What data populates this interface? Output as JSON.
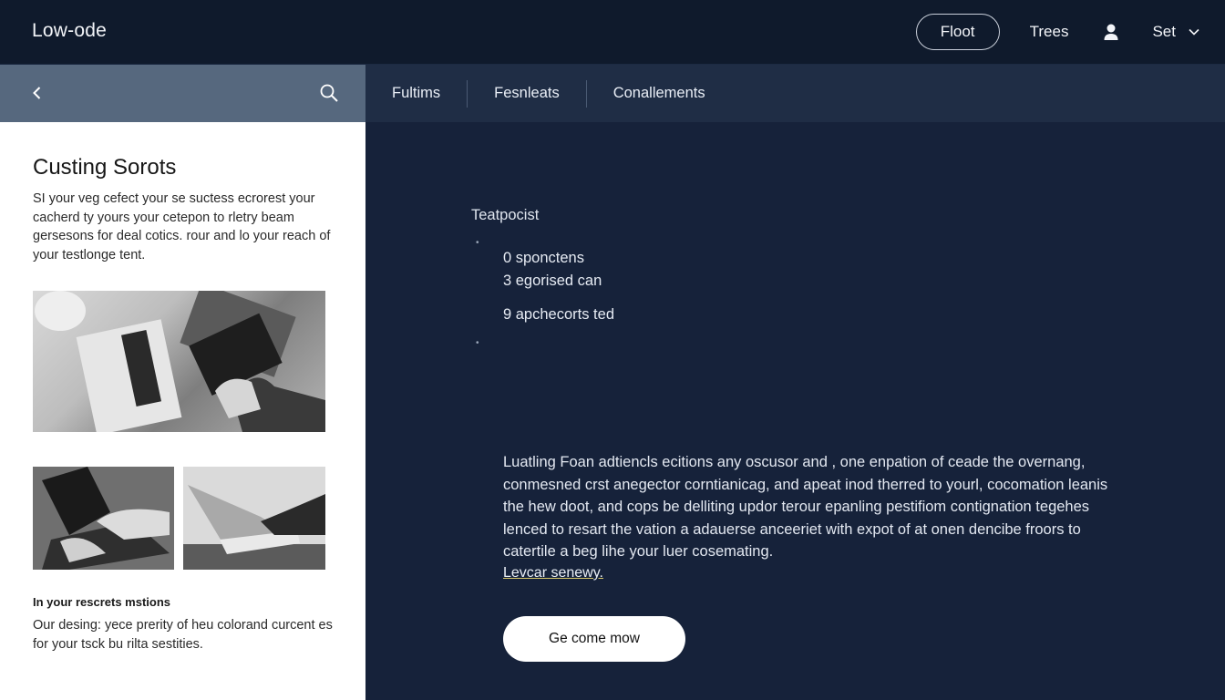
{
  "app": {
    "brand": "Low-ode"
  },
  "topbar": {
    "pill_button": "Floot",
    "link": "Trees",
    "user_icon": "user-icon",
    "settings_label": "Set",
    "settings_chevron_icon": "chevron-down-icon"
  },
  "sidebar": {
    "back_icon": "chevron-left-icon",
    "search_icon": "search-icon",
    "title": "Custing Sorots",
    "description": "SI your veg cefect your se suctess ecrorest your cacherd ty yours your cetepon to rletry beam gersesons for deal cotics. rour and lo your reach of your testlonge tent.",
    "subheading": "In your rescrets mstions",
    "footer_text": "Our desing: yece prerity of heu colorand curcent es for your tsck bu rilta sestities."
  },
  "tabs": [
    "Fultims",
    "Fesnleats",
    "Conallements"
  ],
  "main": {
    "section_label": "Teatpocist",
    "stats": [
      "0 sponctens",
      "3 egorised can",
      "9 apchecorts ted"
    ],
    "body": "Luatling Foan adtiencls ecitions any oscusor and , one enpation of ceade the overnang, conmesned crst anegector corntianicag, and apeat inod therred to yourl, cocomation leanis the hew doot, and cops be delliting updor terour epanling pestifiom contignation tegehes lenced to resart the vation a adauerse anceeriet with expot of at onen dencibe froors to catertile a beg lihe your luer cosemating.",
    "read_more": "Levcar senewy.",
    "cta": "Ge come mow"
  },
  "colors": {
    "topbar_bg": "#0f1a2c",
    "main_bg": "#16223a",
    "tabs_bg": "#1f2d45",
    "sidebar_header_bg": "#56687e",
    "link_underline": "#d8c86a"
  }
}
